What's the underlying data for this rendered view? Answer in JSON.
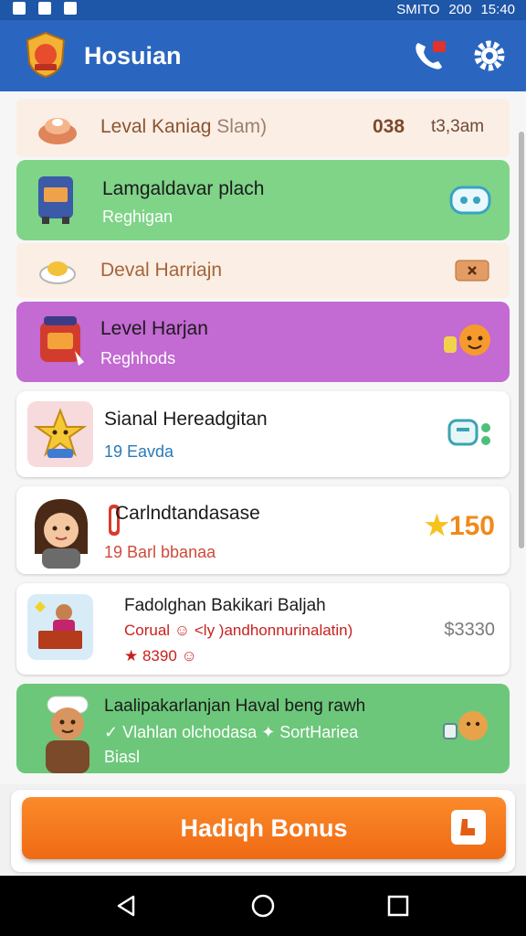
{
  "status_bar": {
    "carrier": "SMITO",
    "signal": "200",
    "time": "15:40"
  },
  "app_bar": {
    "title": "Hosuian"
  },
  "header_rows": [
    {
      "title": "Leval Kaniag",
      "title_suffix": "Slam)",
      "meta_primary": "038",
      "meta_secondary": "t3,3am"
    },
    {
      "title": "Deval Harriajn"
    }
  ],
  "items": [
    {
      "title": "Lamgaldavar plach",
      "subtitle": "Reghigan"
    },
    {
      "title": "Level Harjan",
      "subtitle": "Reghhods"
    },
    {
      "title": "Sianal Hereadgitan",
      "subtitle": "19 Eavda"
    },
    {
      "title": "Carlndtandasase",
      "subtitle": "19 Barl bbanaa",
      "price": "150"
    },
    {
      "title": "Fadolghan Bakikari Baljah",
      "subtitle": "Corual ☺ <ly )andhonnurinalatin)",
      "subtitle2": "★ 8390 ☺",
      "price": "$3330"
    },
    {
      "title": "Laalipakarlanjan Haval beng rawh",
      "subtitle": "✓ Vlahlan olchodasa ✦ SortHariea",
      "subtitle2": "Biasl"
    }
  ],
  "bonus_button": {
    "label": "Hadiqh Bonus"
  },
  "colors": {
    "app_bar": "#2a66bf",
    "green_row": "#7fd488",
    "purple_row": "#c36ad3",
    "peach_row": "#fbeee4",
    "bonus": "#f57a1c"
  },
  "icons": [
    "crest-logo-icon",
    "phone-icon",
    "gear-icon",
    "back-icon",
    "home-icon",
    "recents-icon"
  ]
}
